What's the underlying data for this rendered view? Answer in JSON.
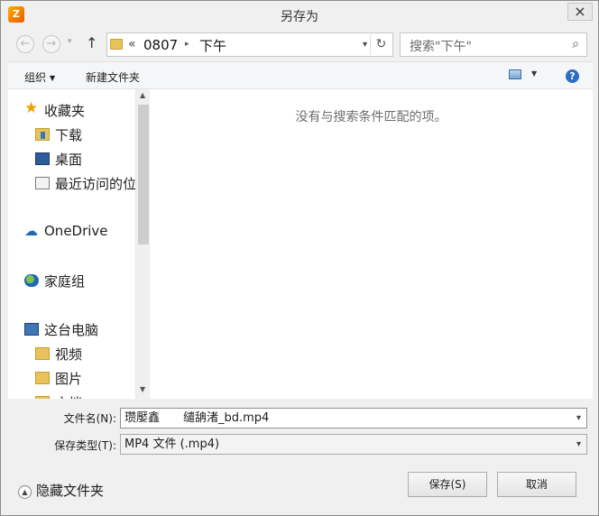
{
  "window": {
    "title": "另存为",
    "app_icon_text": "Z"
  },
  "nav": {
    "back": "←",
    "forward": "→",
    "history": "▾",
    "up": "↑"
  },
  "address": {
    "overflow": "«",
    "crumbs": [
      "0807",
      "下午"
    ],
    "separator": "▸",
    "dropdown": "▾",
    "refresh": "↻"
  },
  "search": {
    "placeholder": "搜索\"下午\""
  },
  "toolbar": {
    "organize": "组织",
    "organize_caret": "▼",
    "new_folder": "新建文件夹",
    "view_caret": "▼",
    "help": "?"
  },
  "sidebar": {
    "items": [
      {
        "label": "收藏夹",
        "icon": "star-icon"
      },
      {
        "label": "下载",
        "icon": "download-folder-icon"
      },
      {
        "label": "桌面",
        "icon": "desktop-icon"
      },
      {
        "label": "最近访问的位",
        "icon": "recent-places-icon"
      },
      {
        "label": "OneDrive",
        "icon": "onedrive-cloud-icon"
      },
      {
        "label": "家庭组",
        "icon": "homegroup-icon"
      },
      {
        "label": "这台电脑",
        "icon": "this-pc-icon"
      },
      {
        "label": "视频",
        "icon": "videos-folder-icon"
      },
      {
        "label": "图片",
        "icon": "pictures-folder-icon"
      },
      {
        "label": "文档",
        "icon": "documents-folder-icon"
      }
    ],
    "scroll_up": "▲",
    "scroll_down": "▼"
  },
  "content": {
    "empty_message": "没有与搜索条件匹配的项。"
  },
  "fields": {
    "filename_label": "文件名(N):",
    "filename_value": "瓒嬮鑫　　缱舑渚_bd.mp4",
    "filetype_label": "保存类型(T):",
    "filetype_value": "MP4 文件 (.mp4)",
    "caret": "▾"
  },
  "footer": {
    "hide_folders": "隐藏文件夹",
    "hide_folders_icon": "▲",
    "save": "保存(S)",
    "cancel": "取消"
  }
}
